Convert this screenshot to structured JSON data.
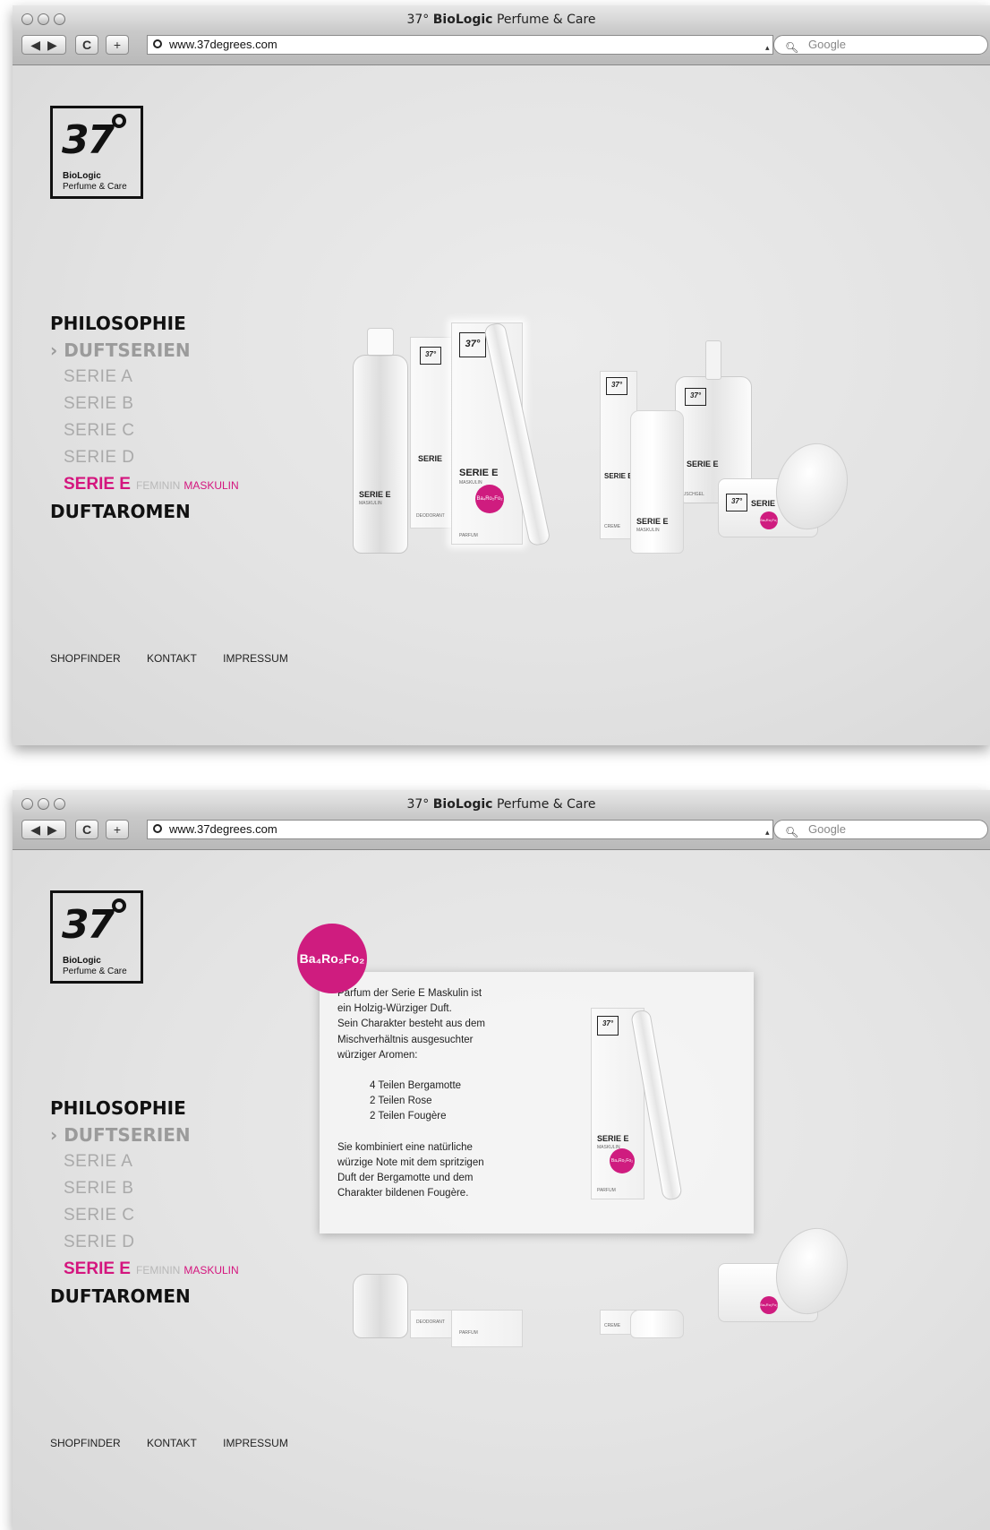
{
  "browser": {
    "title_prefix": "37°",
    "title_bold": "BioLogic",
    "title_rest": "Perfume & Care",
    "url": "www.37degrees.com",
    "search_placeholder": "Google",
    "add_label": "+",
    "reload_label": "C"
  },
  "logo": {
    "number": "37",
    "line1": "BioLogic",
    "line2": "Perfume & Care"
  },
  "nav": {
    "philosophie": "PHILOSOPHIE",
    "duftserien": "› DUFTSERIEN",
    "serie_a": "SERIE A",
    "serie_b": "SERIE B",
    "serie_c": "SERIE C",
    "serie_d": "SERIE D",
    "serie_e": "SERIE E",
    "feminin": "FEMININ",
    "maskulin": "MASKULIN",
    "duftaromen": "DUFTAROMEN"
  },
  "footer": {
    "shopfinder": "SHOPFINDER",
    "kontakt": "KONTAKT",
    "impressum": "IMPRESSUM"
  },
  "products": {
    "serie_e": "SERIE E",
    "maskulin": "MASKULIN",
    "deodorant": "DEODORANT",
    "parfum": "PARFUM",
    "creme": "CREME",
    "duschgel": "DUSCHGEL",
    "serie_short": "SERIE",
    "formula_small": "Ba₄Ro₂Fo₂"
  },
  "popup": {
    "badge": "Ba₄Ro₂Fo₂",
    "p1": "Parfum der Serie E Maskulin ist",
    "p2": "ein Holzig-Würziger Duft.",
    "p3": "Sein Charakter besteht aus dem",
    "p4": "Mischverhältnis ausgesuchter",
    "p5": "würziger Aromen:",
    "i1": "4 Teilen Bergamotte",
    "i2": "2 Teilen Rose",
    "i3": "2 Teilen Fougère",
    "q1": "Sie kombiniert eine natürliche",
    "q2": "würzige Note mit dem spritzigen",
    "q3": "Duft der Bergamotte und dem",
    "q4": "Charakter bildenen Fougère."
  },
  "colors": {
    "accent": "#d4157e",
    "muted": "#aaaaaa"
  }
}
